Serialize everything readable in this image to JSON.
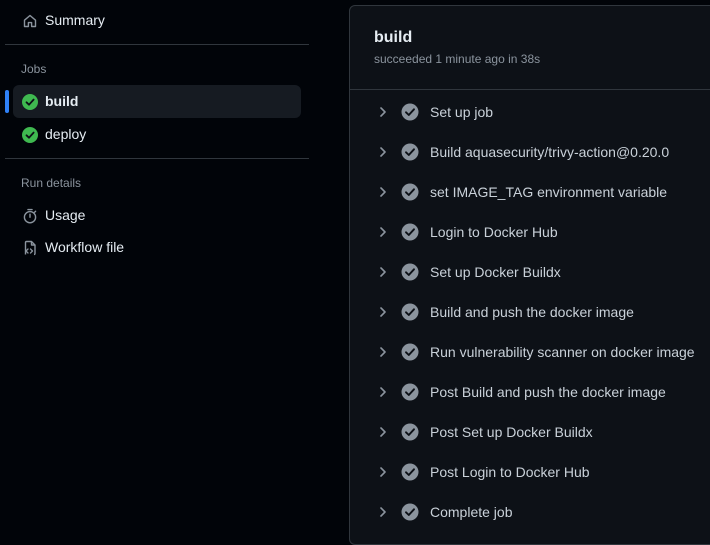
{
  "sidebar": {
    "summary_label": "Summary",
    "jobs_heading": "Jobs",
    "jobs": [
      {
        "label": "build",
        "status": "success",
        "active": true
      },
      {
        "label": "deploy",
        "status": "success",
        "active": false
      }
    ],
    "run_details_heading": "Run details",
    "details": [
      {
        "label": "Usage",
        "icon": "stopwatch-icon"
      },
      {
        "label": "Workflow file",
        "icon": "file-code-icon"
      }
    ]
  },
  "job": {
    "title": "build",
    "subtitle": "succeeded 1 minute ago in 38s",
    "steps": [
      {
        "label": "Set up job",
        "status": "success"
      },
      {
        "label": "Build aquasecurity/trivy-action@0.20.0",
        "status": "success"
      },
      {
        "label": "set IMAGE_TAG environment variable",
        "status": "success"
      },
      {
        "label": "Login to Docker Hub",
        "status": "success"
      },
      {
        "label": "Set up Docker Buildx",
        "status": "success"
      },
      {
        "label": "Build and push the docker image",
        "status": "success"
      },
      {
        "label": "Run vulnerability scanner on docker image",
        "status": "success"
      },
      {
        "label": "Post Build and push the docker image",
        "status": "success"
      },
      {
        "label": "Post Set up Docker Buildx",
        "status": "success"
      },
      {
        "label": "Post Login to Docker Hub",
        "status": "success"
      },
      {
        "label": "Complete job",
        "status": "success"
      }
    ]
  },
  "colors": {
    "success": "#3fb950",
    "step_check": "#8b949e",
    "accent": "#2f81f7"
  }
}
